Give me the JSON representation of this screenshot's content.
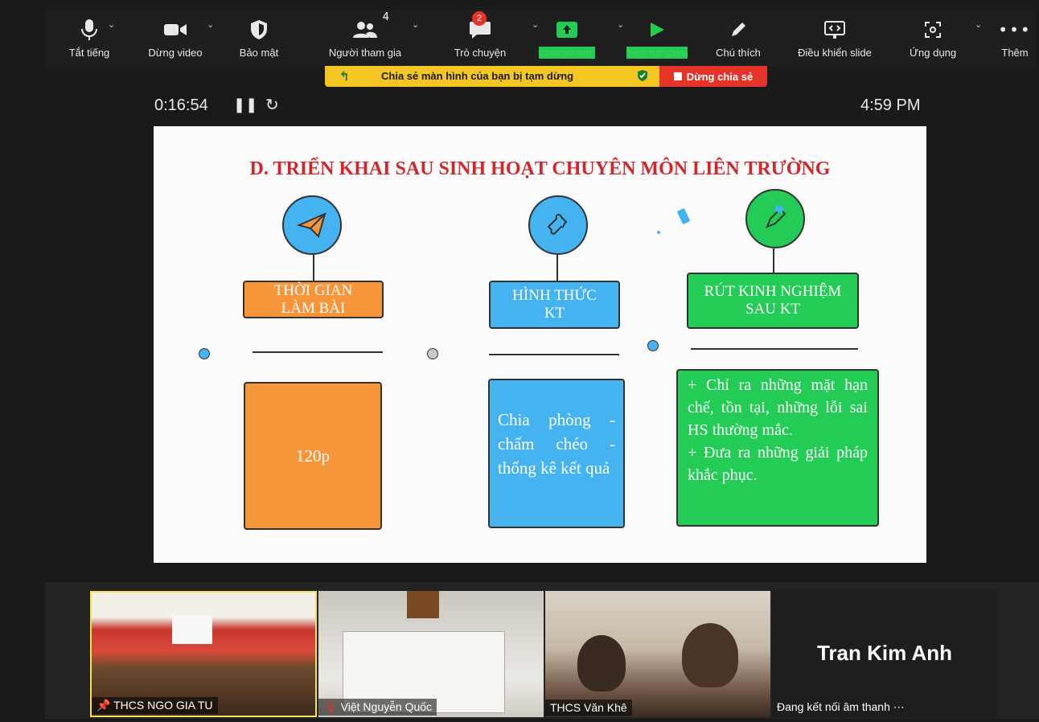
{
  "toolbar": {
    "mute_label": "Tắt tiếng",
    "video_label": "Dừng video",
    "security_label": "Bảo mật",
    "participants_label": "Người tham gia",
    "participants_count": "4",
    "chat_label": "Trò chuyện",
    "chat_badge": "2",
    "new_share_label": "Chia sẻ Mới",
    "resume_share_label": "Tiếp tục Chia",
    "annotate_label": "Chú thích",
    "slide_control_label": "Điều khiển slide",
    "apps_label": "Ứng dụng",
    "more_label": "Thêm"
  },
  "share_bar": {
    "paused_text": "Chia sẻ màn hình của bạn bị tạm dừng",
    "stop_text": "Dừng chia sẻ"
  },
  "timer": {
    "elapsed": "0:16:54",
    "clock": "4:59 PM"
  },
  "slide": {
    "title": "D. TRIỂN KHAI SAU  SINH HOẠT CHUYÊN MÔN LIÊN TRƯỜNG",
    "columns": [
      {
        "label_line1": "THỜI GIAN",
        "label_line2": "LÀM BÀI",
        "content": "120p",
        "icon": "paper-plane-icon",
        "color": "#f7953b"
      },
      {
        "label_line1": "HÌNH THỨC",
        "label_line2": "KT",
        "content": "Chia phòng - chấm chéo - thống kê kết quả",
        "icon": "puzzle-icon",
        "color": "#45b3ef"
      },
      {
        "label_line1": "RÚT KINH NGHIỆM",
        "label_line2": "SAU KT",
        "content_line1": "+ Chỉ ra những mặt hạn chế, tồn tại, những lỗi sai HS thường mắc.",
        "content_line2": "+ Đưa ra những giải pháp khắc phục.",
        "icon": "pencil-hand-icon",
        "color": "#22cc55"
      }
    ]
  },
  "participants": [
    {
      "name": "THCS NGO GIA TU",
      "pinned": true
    },
    {
      "name": "Việt Nguyễn Quốc",
      "muted": true
    },
    {
      "name": "THCS Văn Khê"
    },
    {
      "name": "Tran Kim Anh",
      "status": "Đang kết nối âm thanh ⋯"
    }
  ]
}
